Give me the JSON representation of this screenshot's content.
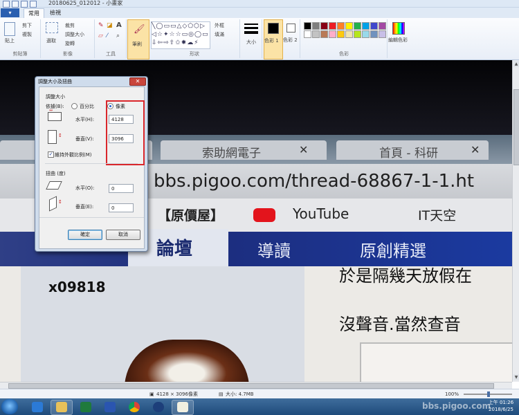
{
  "titlebar": {
    "title": "20180625_012012 - 小畫家"
  },
  "ribbon": {
    "file_label": "▾",
    "tabs": [
      "常用",
      "檢視"
    ],
    "clipboard": {
      "paste": "貼上",
      "cut": "剪下",
      "copy": "複製",
      "label": "剪貼簿"
    },
    "image": {
      "select": "選取",
      "crop": "裁剪",
      "resize": "調整大小",
      "rotate": "旋轉",
      "label": "影像"
    },
    "tools": {
      "label": "工具"
    },
    "brushes": {
      "label": "筆刷"
    },
    "shapes": {
      "outline": "外框",
      "fill": "填滿",
      "label": "形狀"
    },
    "size": {
      "label": "大小"
    },
    "color1": {
      "label": "色彩 1"
    },
    "color2": {
      "label": "色彩 2"
    },
    "edit_colors": {
      "label": "編輯色彩"
    },
    "colors_label": "色彩",
    "palette": [
      "#000000",
      "#7f7f7f",
      "#880015",
      "#ed1c24",
      "#ff7f27",
      "#fff200",
      "#22b14c",
      "#00a2e8",
      "#3f48cc",
      "#a349a4",
      "#ffffff",
      "#c3c3c3",
      "#b97a57",
      "#ffaec9",
      "#ffc90e",
      "#efe4b0",
      "#b5e61d",
      "#99d9ea",
      "#7092be",
      "#c8bfe7"
    ]
  },
  "photo": {
    "tab1": "索助網電子",
    "tab2": "首頁 - 科研",
    "address": "bbs.pigoo.com/thread-68867-1-1.ht",
    "bm1": "【原價屋】",
    "bm2": "YouTube",
    "bm3": "IT天空",
    "nav1": "論壇",
    "nav2": "導讀",
    "nav3": "原創精選",
    "user": "x09818",
    "text1": "於是隔幾天放假在",
    "text2": "沒聲音.當然查音"
  },
  "dialog": {
    "title": "調整大小及扭曲",
    "close": "✕",
    "resize_section": "調整大小",
    "by_label": "依據(B):",
    "percent_label": "百分比",
    "pixels_label": "像素",
    "horizontal_label": "水平(H):",
    "horizontal_value": "4128",
    "vertical_label": "垂直(V):",
    "vertical_value": "3096",
    "keep_ratio_label": "維持外觀比例(M)",
    "skew_section": "扭曲 (度)",
    "skew_h_label": "水平(O):",
    "skew_h_value": "0",
    "skew_v_label": "垂直(E):",
    "skew_v_value": "0",
    "ok": "確定",
    "cancel": "取消"
  },
  "status": {
    "dimensions": "4128 × 3096像素",
    "size": "大小: 4.7MB",
    "zoom": "100%"
  },
  "taskbar": {
    "time": "上午 01:26",
    "date": "2018/6/25",
    "watermark": "bbs.pigoo.com"
  }
}
